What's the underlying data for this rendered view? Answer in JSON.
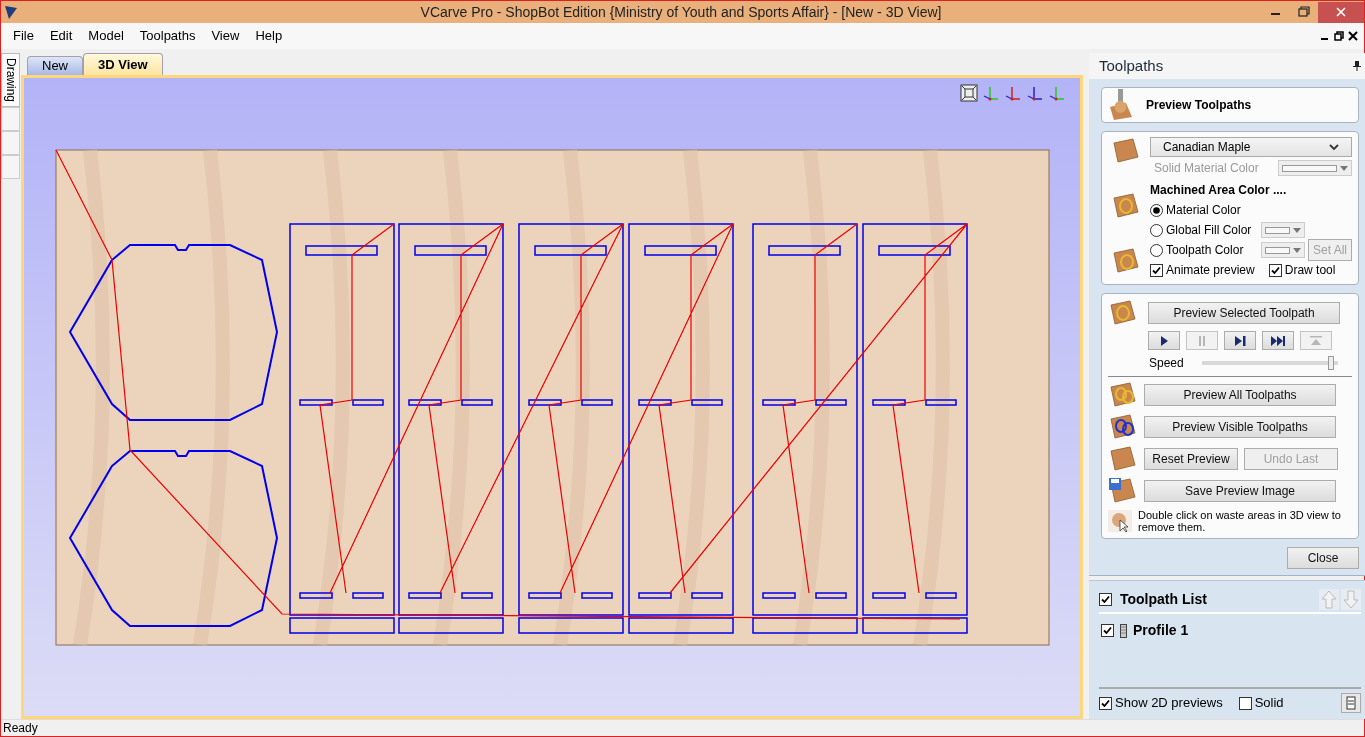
{
  "window": {
    "title": "VCarve Pro - ShopBot Edition {Ministry of Youth and Sports Affair} - [New - 3D View]"
  },
  "menu": [
    "File",
    "Edit",
    "Model",
    "Toolpaths",
    "View",
    "Help"
  ],
  "side_tabs": [
    {
      "label": "Drawing",
      "selected": true
    }
  ],
  "doc_tabs": [
    {
      "label": "New",
      "selected": false
    },
    {
      "label": "3D View",
      "selected": true
    }
  ],
  "panel": {
    "title": "Toolpaths",
    "header": "Preview Toolpaths",
    "material": {
      "value": "Canadian Maple"
    },
    "solid_color_label": "Solid Material Color",
    "machined_label": "Machined Area Color ....",
    "color_options": [
      {
        "label": "Material Color",
        "selected": true,
        "swatch": false
      },
      {
        "label": "Global Fill Color",
        "selected": false,
        "swatch": true
      },
      {
        "label": "Toolpath Color",
        "selected": false,
        "swatch": true
      }
    ],
    "set_all": {
      "label": "Set All",
      "disabled": true
    },
    "options": [
      {
        "label": "Animate preview",
        "checked": true
      },
      {
        "label": "Draw tool",
        "checked": true
      }
    ],
    "preview_selected": "Preview Selected Toolpath",
    "playback": [
      {
        "kind": "play",
        "disabled": false
      },
      {
        "kind": "pause",
        "disabled": true
      },
      {
        "kind": "step",
        "disabled": false
      },
      {
        "kind": "end",
        "disabled": false
      },
      {
        "kind": "top",
        "disabled": true
      }
    ],
    "speed": {
      "label": "Speed",
      "level": 0.97
    },
    "buttons": [
      {
        "label": "Preview All Toolpaths",
        "disabled": false
      },
      {
        "label": "Preview Visible Toolpaths",
        "disabled": false
      },
      {
        "label": "Reset Preview",
        "disabled": false
      },
      {
        "label": "Undo Last",
        "disabled": true
      },
      {
        "label": "Save Preview Image",
        "disabled": false
      }
    ],
    "hint": "Double click on waste areas in 3D view to remove them.",
    "close": "Close"
  },
  "toolpath_list": {
    "title": "Toolpath List",
    "checked": true,
    "items": [
      {
        "label": "Profile 1",
        "checked": true
      }
    ],
    "show_2d": {
      "label": "Show 2D previews",
      "checked": true
    },
    "solid": {
      "label": "Solid",
      "checked": false
    }
  },
  "status_bar": "Ready"
}
